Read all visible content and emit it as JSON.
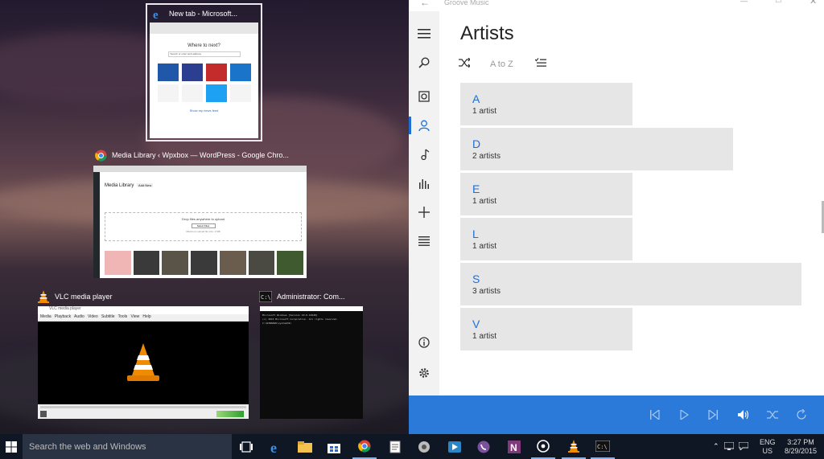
{
  "task_view": {
    "windows": [
      {
        "title": "New tab - Microsoft...",
        "app_icon": "edge-icon",
        "content": {
          "prompt": "Where to next?",
          "search_placeholder": "Search or enter web address",
          "footer_link": "Show my news feed"
        }
      },
      {
        "title": "Media Library ‹ Wpxbox — WordPress - Google Chro...",
        "app_icon": "chrome-icon",
        "content": {
          "page_heading": "Media Library",
          "add_new": "Add New",
          "drop_text": "Drop files anywhere to upload",
          "select_button": "Select Files",
          "upload_limit": "Maximum upload file size: 2 MB"
        }
      },
      {
        "title": "VLC media player",
        "app_icon": "vlc-icon",
        "content": {
          "window_title": "VLC media player",
          "menu": [
            "Media",
            "Playback",
            "Audio",
            "Video",
            "Subtitle",
            "Tools",
            "View",
            "Help"
          ]
        }
      },
      {
        "title": "Administrator: Com...",
        "app_icon": "cmd-icon",
        "content": {
          "lines": [
            "Microsoft Windows [Version 10.0.10240]",
            "(c) 2015 Microsoft Corporation. All rights reserved.",
            "",
            "C:\\WINDOWS\\system32>"
          ]
        }
      }
    ]
  },
  "groove": {
    "window_title": "Groove Music",
    "heading": "Artists",
    "toolbar": {
      "shuffle_icon": "shuffle-icon",
      "sort_label": "A to Z",
      "select_icon": "multi-select-icon"
    },
    "groups": [
      {
        "letter": "A",
        "count": "1 artist"
      },
      {
        "letter": "D",
        "count": "2 artists"
      },
      {
        "letter": "E",
        "count": "1 artist"
      },
      {
        "letter": "L",
        "count": "1 artist"
      },
      {
        "letter": "S",
        "count": "3 artists"
      },
      {
        "letter": "V",
        "count": "1 artist"
      }
    ],
    "nav_icons": [
      "hamburger-icon",
      "search-icon",
      "albums-icon",
      "artists-icon",
      "songs-icon",
      "now-playing-icon",
      "new-playlist-icon",
      "playlists-icon",
      "info-icon",
      "settings-icon"
    ],
    "accent": "#2b7ad9"
  },
  "taskbar": {
    "search_placeholder": "Search the web and Windows",
    "language": "ENG",
    "region": "US",
    "time": "3:27 PM",
    "date": "8/29/2015",
    "apps": [
      "task-view-icon",
      "edge-icon",
      "file-explorer-icon",
      "store-icon",
      "chrome-icon",
      "notepad-icon",
      "app-icon",
      "media-icon",
      "viber-icon",
      "onenote-icon",
      "groove-icon",
      "vlc-icon",
      "cmd-icon"
    ]
  }
}
